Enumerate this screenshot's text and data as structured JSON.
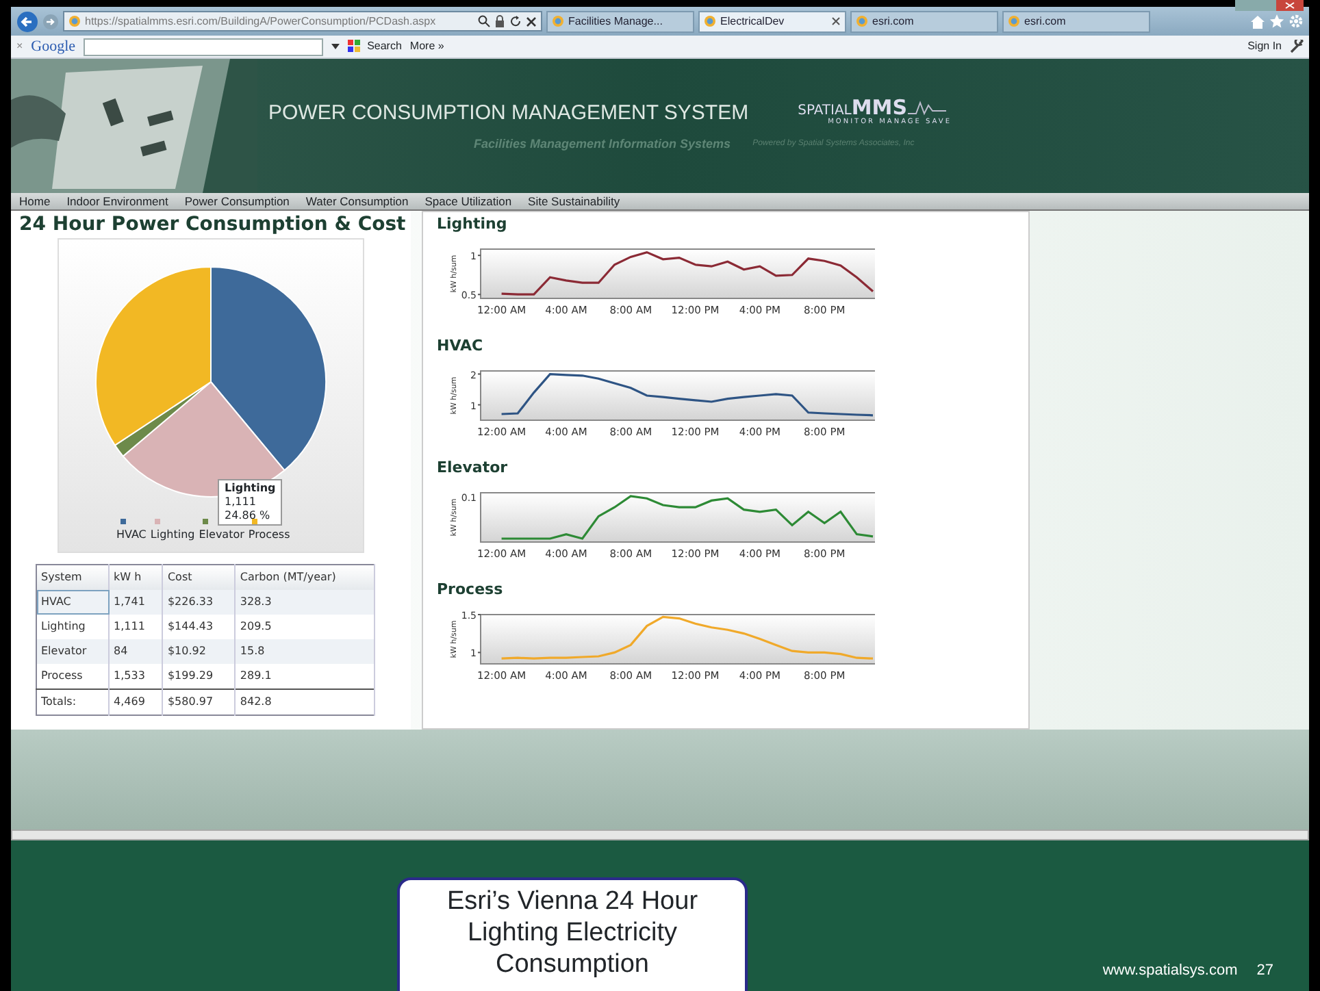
{
  "browser": {
    "address": "https://spatialmms.esri.com/BuildingA/PowerConsumption/PCDash.aspx",
    "tabs": [
      {
        "label": "Facilities Manage...",
        "selected": false,
        "closable": false
      },
      {
        "label": "ElectricalDev",
        "selected": true,
        "closable": true
      },
      {
        "label": "esri.com",
        "selected": false,
        "closable": false
      },
      {
        "label": "esri.com",
        "selected": false,
        "closable": false
      }
    ],
    "toolbar": {
      "close": "×",
      "brand": "Google",
      "search": "Search",
      "more": "More »",
      "sign_in": "Sign In"
    }
  },
  "banner": {
    "title": "POWER CONSUMPTION MANAGEMENT SYSTEM",
    "logo_small": "SPATIAL",
    "logo_big": "MMS",
    "logo_tagline": "MONITOR MANAGE SAVE",
    "subtitle": "Facilities Management Information Systems",
    "powered": "Powered by Spatial Systems Associates, Inc"
  },
  "nav": [
    "Home",
    "Indoor Environment",
    "Power Consumption",
    "Water Consumption",
    "Space Utilization",
    "Site Sustainability"
  ],
  "summary": {
    "title": "24 Hour Power Consumption & Cost",
    "pie": {
      "chart_data": {
        "type": "pie",
        "categories": [
          "HVAC",
          "Lighting",
          "Elevator",
          "Process"
        ],
        "legend": "bottom",
        "series": [
          {
            "colors": [
              "#3e6a9a",
              "#d9b3b5",
              "#6d8a4a",
              "#f2b824"
            ],
            "values": [
              38.96,
              24.86,
              1.88,
              34.3
            ]
          }
        ]
      },
      "tooltip": {
        "title": "Lighting",
        "value": "1,111",
        "percent": "24.86 %"
      }
    },
    "table": {
      "columns": [
        "System",
        "kW h",
        "Cost",
        "Carbon (MT/year)"
      ],
      "rows": [
        {
          "cells": [
            "HVAC",
            "1,741",
            "$226.33",
            "328.3"
          ],
          "selected": true
        },
        {
          "cells": [
            "Lighting",
            "1,111",
            "$144.43",
            "209.5"
          ],
          "selected": false
        },
        {
          "cells": [
            "Elevator",
            "84",
            "$10.92",
            "15.8"
          ],
          "selected": false
        },
        {
          "cells": [
            "Process",
            "1,533",
            "$199.29",
            "289.1"
          ],
          "selected": false
        }
      ],
      "totals": [
        "Totals:",
        "4,469",
        "$580.97",
        "842.8"
      ]
    }
  },
  "charts": [
    {
      "title": "Lighting",
      "chart_data": {
        "type": "line",
        "ylabel": "kW h/sum",
        "x": [
          0,
          1,
          2,
          3,
          4,
          5,
          6,
          7,
          8,
          9,
          10,
          11,
          12,
          13,
          14,
          15,
          16,
          17,
          18,
          19,
          20,
          21,
          22,
          23
        ],
        "xlim": [
          -1.3,
          23.3
        ],
        "ylim": [
          0.45,
          1.08
        ],
        "yticks": [
          0.5,
          1
        ],
        "xticks": [
          {
            "value": 0,
            "label": "12:00 AM"
          },
          {
            "value": 4,
            "label": "4:00 AM"
          },
          {
            "value": 8,
            "label": "8:00 AM"
          },
          {
            "value": 12,
            "label": "12:00 PM"
          },
          {
            "value": 16,
            "label": "4:00 PM"
          },
          {
            "value": 20,
            "label": "8:00 PM"
          }
        ],
        "series": [
          {
            "color": "#8b2a35",
            "values": [
              0.51,
              0.5,
              0.5,
              0.72,
              0.68,
              0.65,
              0.65,
              0.88,
              0.98,
              1.04,
              0.95,
              0.97,
              0.88,
              0.86,
              0.92,
              0.82,
              0.86,
              0.74,
              0.75,
              0.96,
              0.93,
              0.87,
              0.72,
              0.54
            ]
          }
        ]
      }
    },
    {
      "title": "HVAC",
      "chart_data": {
        "type": "line",
        "ylabel": "kW h/sum",
        "x": [
          0,
          1,
          2,
          3,
          4,
          5,
          6,
          7,
          8,
          9,
          10,
          11,
          12,
          13,
          14,
          15,
          16,
          17,
          18,
          19,
          20,
          21,
          22,
          23
        ],
        "xlim": [
          -1.3,
          23.3
        ],
        "ylim": [
          0.5,
          2.1
        ],
        "yticks": [
          1,
          2
        ],
        "xticks": [
          {
            "value": 0,
            "label": "12:00 AM"
          },
          {
            "value": 4,
            "label": "4:00 AM"
          },
          {
            "value": 8,
            "label": "8:00 AM"
          },
          {
            "value": 12,
            "label": "12:00 PM"
          },
          {
            "value": 16,
            "label": "4:00 PM"
          },
          {
            "value": 20,
            "label": "8:00 PM"
          }
        ],
        "series": [
          {
            "color": "#2e5484",
            "values": [
              0.7,
              0.72,
              1.4,
              2.0,
              1.97,
              1.95,
              1.85,
              1.7,
              1.55,
              1.3,
              1.25,
              1.2,
              1.15,
              1.1,
              1.2,
              1.25,
              1.3,
              1.35,
              1.3,
              0.75,
              0.72,
              0.7,
              0.68,
              0.66
            ]
          }
        ]
      }
    },
    {
      "title": "Elevator",
      "sparkline": {
        "ylabel": "kW h/sum",
        "y_label": "0.1",
        "x_labels": [
          "12:00 AM",
          "4:00 AM",
          "8:00 AM",
          "12:00 PM",
          "4:00 PM",
          "8:00 PM"
        ]
      }
    },
    {
      "title": "Process",
      "chart_data": {
        "type": "line",
        "ylabel": "kW h/sum",
        "x": [
          0,
          1,
          2,
          3,
          4,
          5,
          6,
          7,
          8,
          9,
          10,
          11,
          12,
          13,
          14,
          15,
          16,
          17,
          18,
          19,
          20,
          21,
          22,
          23
        ],
        "xlim": [
          -1.3,
          23.3
        ],
        "ylim": [
          0.85,
          1.5
        ],
        "yticks": [
          1,
          1.5
        ],
        "xticks": [
          {
            "value": 0,
            "label": "12:00 AM"
          },
          {
            "value": 4,
            "label": "4:00 AM"
          },
          {
            "value": 8,
            "label": "8:00 AM"
          },
          {
            "value": 12,
            "label": "12:00 PM"
          },
          {
            "value": 16,
            "label": "4:00 PM"
          },
          {
            "value": 20,
            "label": "8:00 PM"
          }
        ],
        "series": [
          {
            "color": "#f0a92a",
            "values": [
              0.92,
              0.93,
              0.92,
              0.93,
              0.93,
              0.94,
              0.95,
              1.0,
              1.1,
              1.35,
              1.47,
              1.45,
              1.38,
              1.33,
              1.3,
              1.25,
              1.18,
              1.1,
              1.02,
              1.0,
              1.0,
              0.98,
              0.93,
              0.92
            ]
          }
        ]
      }
    }
  ],
  "slide": {
    "callout": "Esri’s Vienna 24 Hour Lighting Electricity Consumption",
    "website": "www.spatialsys.com",
    "page": "27"
  }
}
